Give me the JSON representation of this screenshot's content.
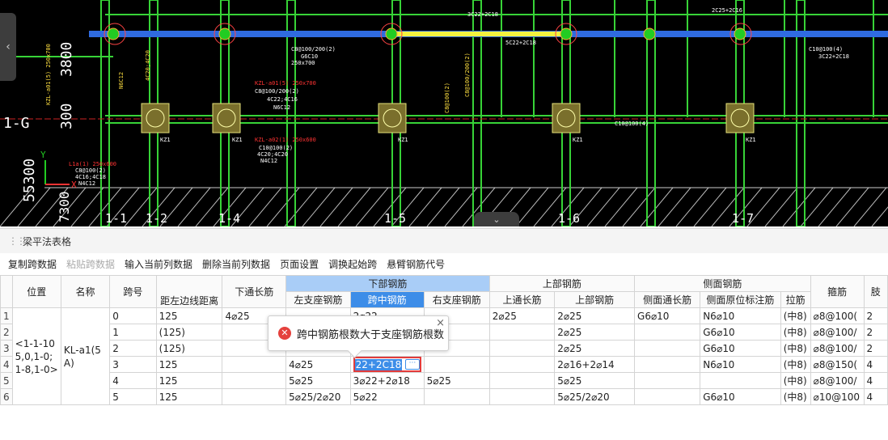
{
  "panel": {
    "title": "梁平法表格"
  },
  "toolbar": {
    "buttons": [
      "复制跨数据",
      "粘贴跨数据",
      "输入当前列数据",
      "删除当前列数据",
      "页面设置",
      "调换起始跨",
      "悬臂钢筋代号"
    ],
    "disabled_index": 1
  },
  "table": {
    "headers": {
      "position": "位置",
      "name": "名称",
      "span_no": "跨号",
      "dist_left": "距左边线距离",
      "bottom_through": "下通长筋",
      "bottom_group": "下部钢筋",
      "left_support": "左支座钢筋",
      "mid_span": "跨中钢筋",
      "right_support": "右支座钢筋",
      "top_group": "上部钢筋",
      "top_through": "上通长筋",
      "top_rebar": "上部钢筋",
      "side_group": "侧面钢筋",
      "side_through": "侧面通长筋",
      "side_origin": "侧面原位标注筋",
      "tie": "拉筋",
      "stirrup": "箍筋",
      "extra": "肢"
    },
    "merged": {
      "position": "<1-1-105,0,1-0;1-8,1-0>",
      "name": "KL-a1(5A)"
    },
    "rows": [
      {
        "num": "1",
        "span": "0",
        "dist": "125",
        "bottom_through": "4⌀25",
        "left": "",
        "mid": "2⌀22",
        "right": "",
        "top_through": "2⌀25",
        "top": "2⌀25",
        "side_through": "G6⌀10",
        "side_origin": "N6⌀10",
        "tie": "(中8)",
        "stirrup": "⌀8@100(",
        "legs": "2"
      },
      {
        "num": "2",
        "span": "1",
        "dist": "(125)",
        "bottom_through": "",
        "left": "",
        "mid": "",
        "right": "",
        "top_through": "",
        "top": "2⌀25",
        "side_through": "",
        "side_origin": "G6⌀10",
        "tie": "(中8)",
        "stirrup": "⌀8@100/",
        "legs": "2"
      },
      {
        "num": "3",
        "span": "2",
        "dist": "(125)",
        "bottom_through": "",
        "left": "",
        "mid": "",
        "right": "",
        "top_through": "",
        "top": "2⌀25",
        "side_through": "",
        "side_origin": "G6⌀10",
        "tie": "(中8)",
        "stirrup": "⌀8@100/",
        "legs": "2"
      },
      {
        "num": "4",
        "span": "3",
        "dist": "125",
        "bottom_through": "",
        "left": "4⌀25",
        "mid": "22+2C18",
        "right": "",
        "top_through": "",
        "top": "2⌀16+2⌀14",
        "side_through": "",
        "side_origin": "N6⌀10",
        "tie": "(中8)",
        "stirrup": "⌀8@150(",
        "legs": "4"
      },
      {
        "num": "5",
        "span": "4",
        "dist": "125",
        "bottom_through": "",
        "left": "5⌀25",
        "mid": "3⌀22+2⌀18",
        "right": "5⌀25",
        "top_through": "",
        "top": "5⌀25",
        "side_through": "",
        "side_origin": "",
        "tie": "(中8)",
        "stirrup": "⌀8@100/",
        "legs": "4"
      },
      {
        "num": "6",
        "span": "5",
        "dist": "125",
        "bottom_through": "",
        "left": "5⌀25/2⌀20",
        "mid": "5⌀22",
        "right": "",
        "top_through": "",
        "top": "5⌀25/2⌀20",
        "side_through": "",
        "side_origin": "G6⌀10",
        "tie": "(中8)",
        "stirrup": "⌀10@100",
        "legs": "4"
      }
    ]
  },
  "tooltip": {
    "message": "跨中钢筋根数大于支座钢筋根数",
    "close": "×",
    "error_glyph": "✕"
  },
  "edit_more": "···",
  "cad": {
    "axis_labels": [
      "1-1",
      "1-2",
      "1-4",
      "1-5",
      "1-6",
      "1-7"
    ],
    "left_labels": [
      "U",
      "1-G",
      "3800",
      "300",
      "55300",
      "7300"
    ],
    "coord_y": "Y",
    "coord_x": "X",
    "beam_labels": [
      "KZL-a01(5) 250x700",
      "C8@100/200(2)",
      "4C22;4C16",
      "N6C12",
      "KZL-a02(1) 250x600",
      "C10@100(2)",
      "4C20;4C20",
      "N4C12",
      "L1a(1) 250x600",
      "C8@100(2)",
      "4C16;4C18",
      "N4C12",
      "C8@100/200(2)",
      "G6C10",
      "250x700",
      "C10@100(4)",
      "3C22+2C18",
      "5C22+2C18",
      "2C25+2C16"
    ],
    "column_labels": [
      "KZ1",
      "KZ1",
      "KZ1",
      "KZ1",
      "KZ1"
    ]
  }
}
